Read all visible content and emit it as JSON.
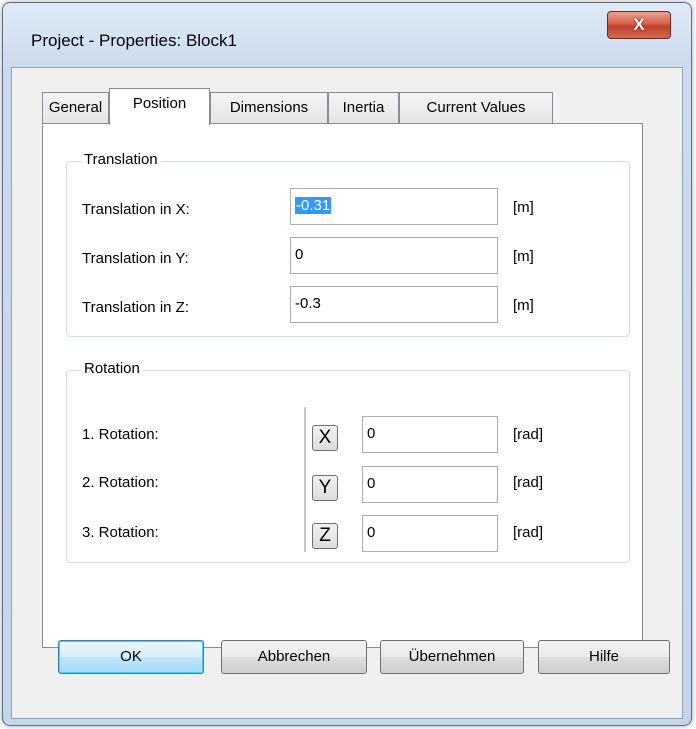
{
  "window": {
    "title": "Project - Properties: Block1",
    "close_glyph": "X"
  },
  "tabs": [
    {
      "label": "General"
    },
    {
      "label": "Position"
    },
    {
      "label": "Dimensions"
    },
    {
      "label": "Inertia"
    },
    {
      "label": "Current Values"
    }
  ],
  "active_tab": "Position",
  "translation": {
    "legend": "Translation",
    "rows": [
      {
        "label": "Translation in X:",
        "value": "-0.31",
        "unit": "[m]"
      },
      {
        "label": "Translation in Y:",
        "value": "0",
        "unit": "[m]"
      },
      {
        "label": "Translation in Z:",
        "value": "-0.3",
        "unit": "[m]"
      }
    ]
  },
  "rotation": {
    "legend": "Rotation",
    "rows": [
      {
        "label": "1. Rotation:",
        "axis": "X",
        "value": "0",
        "unit": "[rad]"
      },
      {
        "label": "2. Rotation:",
        "axis": "Y",
        "value": "0",
        "unit": "[rad]"
      },
      {
        "label": "3. Rotation:",
        "axis": "Z",
        "value": "0",
        "unit": "[rad]"
      }
    ]
  },
  "buttons": {
    "ok": "OK",
    "cancel": "Abbrechen",
    "apply": "Übernehmen",
    "help": "Hilfe"
  }
}
